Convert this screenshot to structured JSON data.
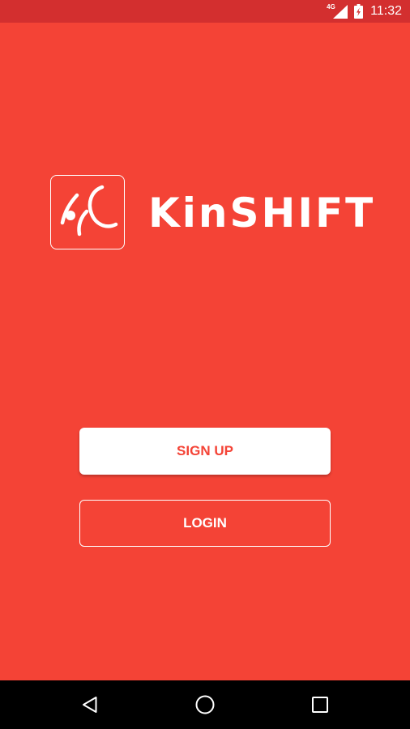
{
  "status_bar": {
    "network_type": "4G",
    "time": "11:32",
    "icons": [
      "signal-icon",
      "battery-icon"
    ]
  },
  "brand": {
    "app_name": "KinSHIFT",
    "logo_icon": "kinshift-logo-icon"
  },
  "actions": {
    "signup_label": "SIGN UP",
    "login_label": "LOGIN"
  },
  "navigation": {
    "icons": [
      "back-icon",
      "home-icon",
      "recents-icon"
    ]
  },
  "colors": {
    "primary": "#f44336",
    "status_bar": "#d32f2f",
    "nav_bar": "#000000",
    "button_text": "#f44336",
    "foreground": "#ffffff"
  }
}
